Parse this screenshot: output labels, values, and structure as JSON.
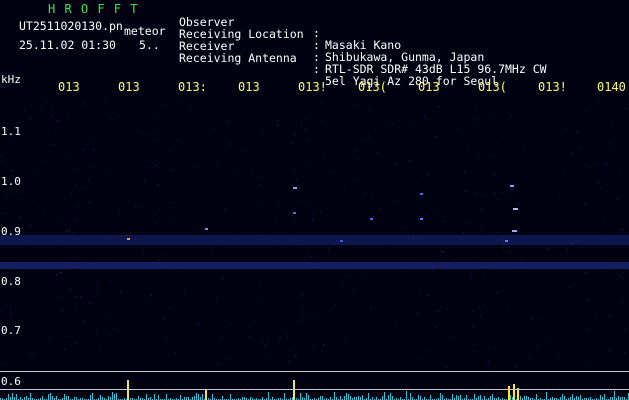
{
  "header": {
    "app_name": "H R O F F T",
    "filename": "UT2511020130.pn",
    "mode": "meteor",
    "datetime": "25.11.02 01:30",
    "count": "5.."
  },
  "info": [
    {
      "label": "Observer",
      "value": "Masaki Kano"
    },
    {
      "label": "Receiving Location",
      "value": "Shibukawa, Gunma, Japan"
    },
    {
      "label": "Receiver",
      "value": "RTL-SDR SDR# 43dB L15 96.7MHz CW"
    },
    {
      "label": "Receiving Antenna",
      "value": "5el Yagi Az 280 for Seoul"
    }
  ],
  "axis": {
    "unit": "kHz",
    "x_ticks": [
      "013",
      "013",
      "013:",
      "013",
      "013!",
      "013(",
      "013",
      "013(",
      "013!",
      "0140"
    ],
    "y_ticks": [
      "1.1",
      "1.0",
      "0.9",
      "0.8",
      "0.7",
      "0.6"
    ]
  },
  "colors": {
    "background": "#000010",
    "header_green": "#34e64a",
    "tick_yellow": "#ffff66",
    "signal_blue": "#3a4fd8",
    "activity_cyan": "#22c6d8"
  }
}
